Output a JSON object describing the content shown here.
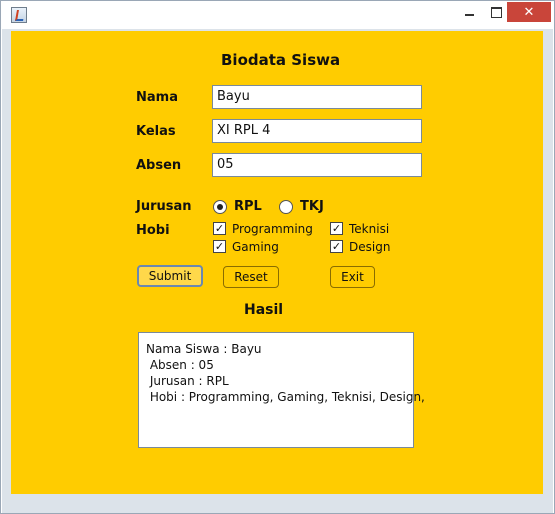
{
  "window": {
    "close_symbol": "✕"
  },
  "form": {
    "title": "Biodata Siswa",
    "nama_label": "Nama",
    "nama_value": "Bayu",
    "kelas_label": "Kelas",
    "kelas_value": "XI RPL 4",
    "absen_label": "Absen",
    "absen_value": "05",
    "jurusan_label": "Jurusan",
    "jurusan_options": [
      {
        "label": "RPL",
        "selected": true
      },
      {
        "label": "TKJ",
        "selected": false
      }
    ],
    "hobi_label": "Hobi",
    "hobi_options": [
      {
        "label": "Programming",
        "checked": true
      },
      {
        "label": "Teknisi",
        "checked": true
      },
      {
        "label": "Gaming",
        "checked": true
      },
      {
        "label": "Design",
        "checked": true
      }
    ],
    "buttons": {
      "submit": "Submit",
      "reset": "Reset",
      "exit": "Exit"
    }
  },
  "result": {
    "title": "Hasil",
    "lines": [
      "Nama Siswa : Bayu",
      " Absen : 05",
      " Jurusan : RPL",
      " Hobi : Programming, Gaming, Teknisi, Design,"
    ]
  },
  "colors": {
    "panel": "#ffcc00",
    "close_button": "#c9453a"
  },
  "icons": {
    "app": "java-app-icon",
    "check_mark": "✓"
  }
}
